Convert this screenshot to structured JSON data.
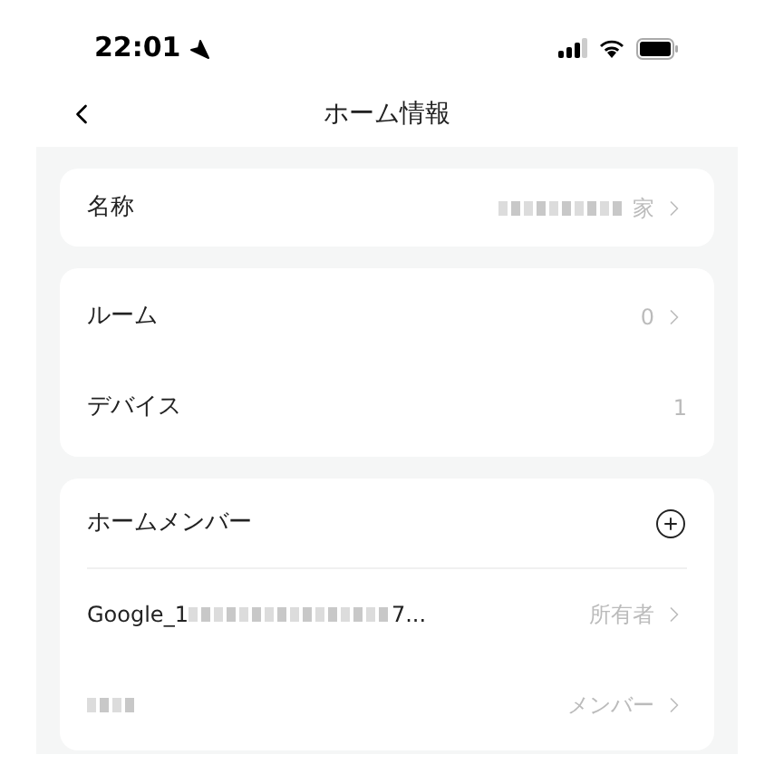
{
  "status_bar": {
    "time": "22:01"
  },
  "nav": {
    "title": "ホーム情報"
  },
  "name_card": {
    "label": "名称",
    "value": "家"
  },
  "info_card": [
    {
      "label": "ルーム",
      "value": "0",
      "chevron": true
    },
    {
      "label": "デバイス",
      "value": "1",
      "chevron": false
    }
  ],
  "members_card": {
    "title": "ホームメンバー",
    "members": [
      {
        "name_start": "Google_1",
        "name_end": "7...",
        "role": "所有者"
      },
      {
        "role": "メンバー"
      }
    ]
  }
}
